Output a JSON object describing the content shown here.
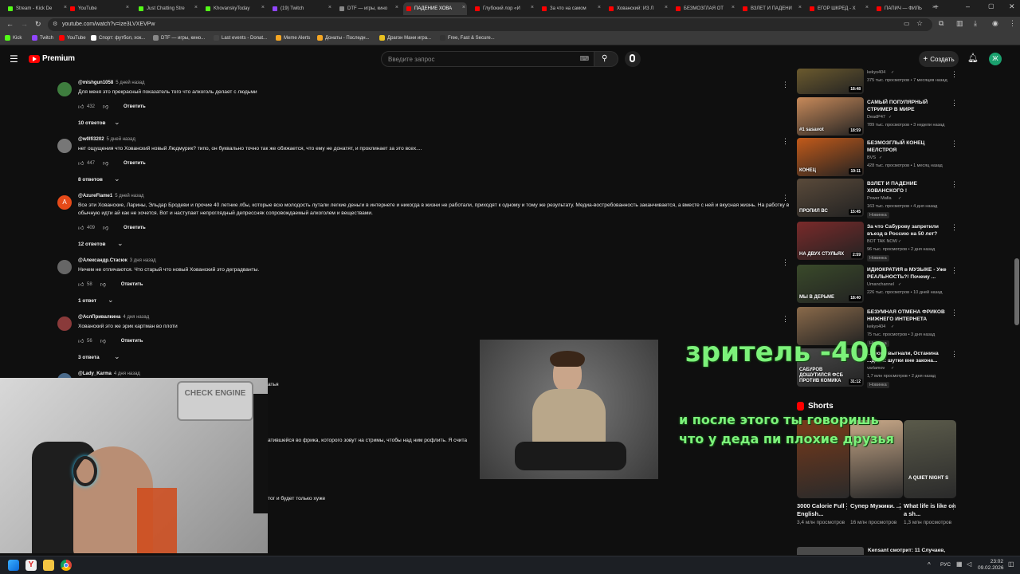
{
  "browser": {
    "tabs": [
      {
        "label": "Stream - Kick De",
        "color": "#53fc18"
      },
      {
        "label": "YouTube",
        "color": "#ff0000"
      },
      {
        "label": "Just Chatting Stre",
        "color": "#53fc18"
      },
      {
        "label": "KhovanskyToday",
        "color": "#53fc18"
      },
      {
        "label": "(19) Twitch",
        "color": "#9146ff"
      },
      {
        "label": "DTF — игры, кино",
        "color": "#888888"
      },
      {
        "label": "ПАДЕНИЕ ХОВА",
        "color": "#ff0000"
      },
      {
        "label": "Глубокий лор «И",
        "color": "#ff0000"
      },
      {
        "label": "За что на самом",
        "color": "#ff0000"
      },
      {
        "label": "Хованский: ИЗ Л",
        "color": "#ff0000"
      },
      {
        "label": "БЕЗМОЗГЛАЯ ОТ",
        "color": "#ff0000"
      },
      {
        "label": "ВЗЛЕТ И ПАДЕНИ",
        "color": "#ff0000"
      },
      {
        "label": "ЕГОР ШКРЕД - Х",
        "color": "#ff0000"
      },
      {
        "label": "ПАПИЧ — ФИЛЬ",
        "color": "#ff0000"
      }
    ],
    "url": "youtube.com/watch?v=ize3LVXEVPw",
    "bookmarks": [
      {
        "label": "Kick",
        "color": "#53fc18"
      },
      {
        "label": "Twitch",
        "color": "#9146ff"
      },
      {
        "label": "YouTube",
        "color": "#ff0000"
      },
      {
        "label": "Спорт: футбол, хок...",
        "color": "#ffffff"
      },
      {
        "label": "DTF — игры, кино...",
        "color": "#888888"
      },
      {
        "label": "Last events - Donat...",
        "color": "#444444"
      },
      {
        "label": "Meme Alerts",
        "color": "#f5a623"
      },
      {
        "label": "Донаты - Последн...",
        "color": "#f5a623"
      },
      {
        "label": "Драгон Мани игра...",
        "color": "#e8c020"
      },
      {
        "label": "Free, Fast & Secure...",
        "color": "#333333"
      }
    ]
  },
  "header": {
    "brand": "Premium",
    "search_placeholder": "Введите запрос",
    "create_label": "Создать",
    "avatar_letter": "Ж"
  },
  "comments": [
    {
      "author": "@mishgun1058",
      "time": "5 дней назад",
      "text": "Для меня это прекрасный показатель того что алкоголь делает с людьми",
      "likes": "432",
      "reply": "Ответить",
      "replies": "10 ответов",
      "avatar_color": "#3e7d3e"
    },
    {
      "author": "@w0lfi3202",
      "time": "5 дней назад",
      "text": "нет ощущения что Хованский новый Людмурик? типо, он буквально точно так же обижается, что ему не донатят, и проклинает за это всех....",
      "likes": "447",
      "reply": "Ответить",
      "replies": "8 ответов",
      "avatar_color": "#777777"
    },
    {
      "author": "@AzureFlame1",
      "time": "5 дней назад",
      "text": "Все эти Хованские, Ларины, Эльдар Бродеви и прочие 40 летние лбы, которые всю молодость лутали легкие деньги в интернете и никогда в жизни не работали, приходят к одному и тому же результату. Медиа-востребованность заканчивается, а вместе с ней и вкусная жизнь. На работку в обычную идти ай как не хочется. Вот и наступает непроглядный депрессняк сопровождаемый алкоголем и веществами.",
      "likes": "409",
      "reply": "Ответить",
      "replies": "12 ответов",
      "avatar_color": "#e64a19",
      "avatar_letter": "A"
    },
    {
      "author": "@Александр.Стасюк",
      "time": "3 дня назад",
      "text": "Ничем не отличаются. Что старый что новый Хованский это деградванты.",
      "likes": "58",
      "reply": "Ответить",
      "replies": "1 ответ",
      "avatar_color": "#666666"
    },
    {
      "author": "@АслПривалкина",
      "time": "4 дня назад",
      "text": "Хованский это же эрик картман во плоти",
      "likes": "56",
      "reply": "Ответить",
      "replies": "3 ответа",
      "avatar_color": "#8a3a3a"
    },
    {
      "author": "@Lady_Karma",
      "time": "4 дня назад",
      "text": "",
      "avatar_color": "#4a6a8a"
    }
  ],
  "partial_texts": {
    "line1": "атья",
    "line2": "атившейся во фрика, которого зовут на стримы, чтобы над ним рофлить. Я счита",
    "line3": "тог и будет только хуже"
  },
  "sidebar": {
    "videos": [
      {
        "title": "",
        "channel": "kekys404",
        "meta": "375 тыс. просмотров • 7 месяцев назад",
        "duration": "18:48",
        "thumb": "#6b5a2e"
      },
      {
        "title": "САМЫЙ ПОПУЛЯРНЫЙ СТРИМЕР В МИРЕ",
        "channel": "DeadP47",
        "meta": "789 тыс. просмотров • 3 недели назад",
        "duration": "18:59",
        "thumb": "#c88a5a",
        "thumb_text": "#1 sasavot"
      },
      {
        "title": "БЕЗМОЗГЛЫЙ КОНЕЦ МЕЛСТРОЯ",
        "channel": "BVS",
        "meta": "428 тыс. просмотров • 1 месяц назад",
        "duration": "19:11",
        "thumb": "#c25a1a",
        "thumb_text": "КОНЕЦ"
      },
      {
        "title": "ВЗЛЕТ И ПАДЕНИЕ ХОВАНСКОГО !",
        "channel": "Power Mafia",
        "meta": "163 тыс. просмотров • 4 дня назад",
        "duration": "15:45",
        "thumb": "#5a4a3a",
        "thumb_text": "ПРОПИЛ ВС",
        "badge": "Новинка"
      },
      {
        "title": "За что Сабурову запретили въезд в Россию на 50 лет?",
        "channel": "BOT TAK NOW",
        "meta": "96 тыс. просмотров • 2 дня назад",
        "duration": "2:59",
        "thumb": "#7a2a2a",
        "thumb_text": "НА ДВУХ СТУЛЬЯХ",
        "badge": "Новинка"
      },
      {
        "title": "ИДИОКРАТИЯ в МУЗЫКЕ - Уже РЕАЛЬНОСТЬ?! Почему ...",
        "channel": "Umanchannel",
        "meta": "226 тыс. просмотров • 10 дней назад",
        "duration": "18:40",
        "thumb": "#3a4a2a",
        "thumb_text": "МЫ В ДЕРЬМЕ"
      },
      {
        "title": "БЕЗУМНАЯ ОТМЕНА ФРИКОВ НИЖНЕГО ИНТЕРНЕТА",
        "channel": "kekys404",
        "meta": "75 тыс. просмотров • 3 дня назад",
        "duration": "",
        "thumb": "#8a6a4a",
        "badge": "Новинка"
      },
      {
        "title": "...трова выгнали, Останина ...дили: шутки вне закона...",
        "channel": "varlamov",
        "meta": "1,7 млн просмотров • 2 дня назад",
        "duration": "31:12",
        "thumb": "#4a4a4a",
        "thumb_text": "САБУРОВ ДОШУТИЛСЯ ФСБ ПРОТИВ КОМИКА",
        "badge": "Новинка"
      }
    ],
    "shorts_title": "Shorts",
    "shorts": [
      {
        "title": "3000 Calorie Full English...",
        "views": "3,4 млн просмотров",
        "thumb": "#7a3a1a"
      },
      {
        "title": "Супер Мужики. ...",
        "views": "16 млн просмотров",
        "thumb": "#c8a888"
      },
      {
        "title": "What life is like on a sh...",
        "views": "1,3 млн просмотров",
        "thumb": "#5a5a4a",
        "overlay": "A QUIET NIGHT S"
      }
    ],
    "bottom_item": "Kensant смотрит: 11 Случаев,"
  },
  "overlay": {
    "green_big": "зритель -400",
    "green_line1": "и после этого ты говоришь",
    "green_line2": "что у деда пи плохие друзья",
    "webcam_sign": "CHECK ENGINE"
  },
  "taskbar": {
    "lang": "РУС",
    "time": "23:02",
    "date": "09.02.2026"
  }
}
